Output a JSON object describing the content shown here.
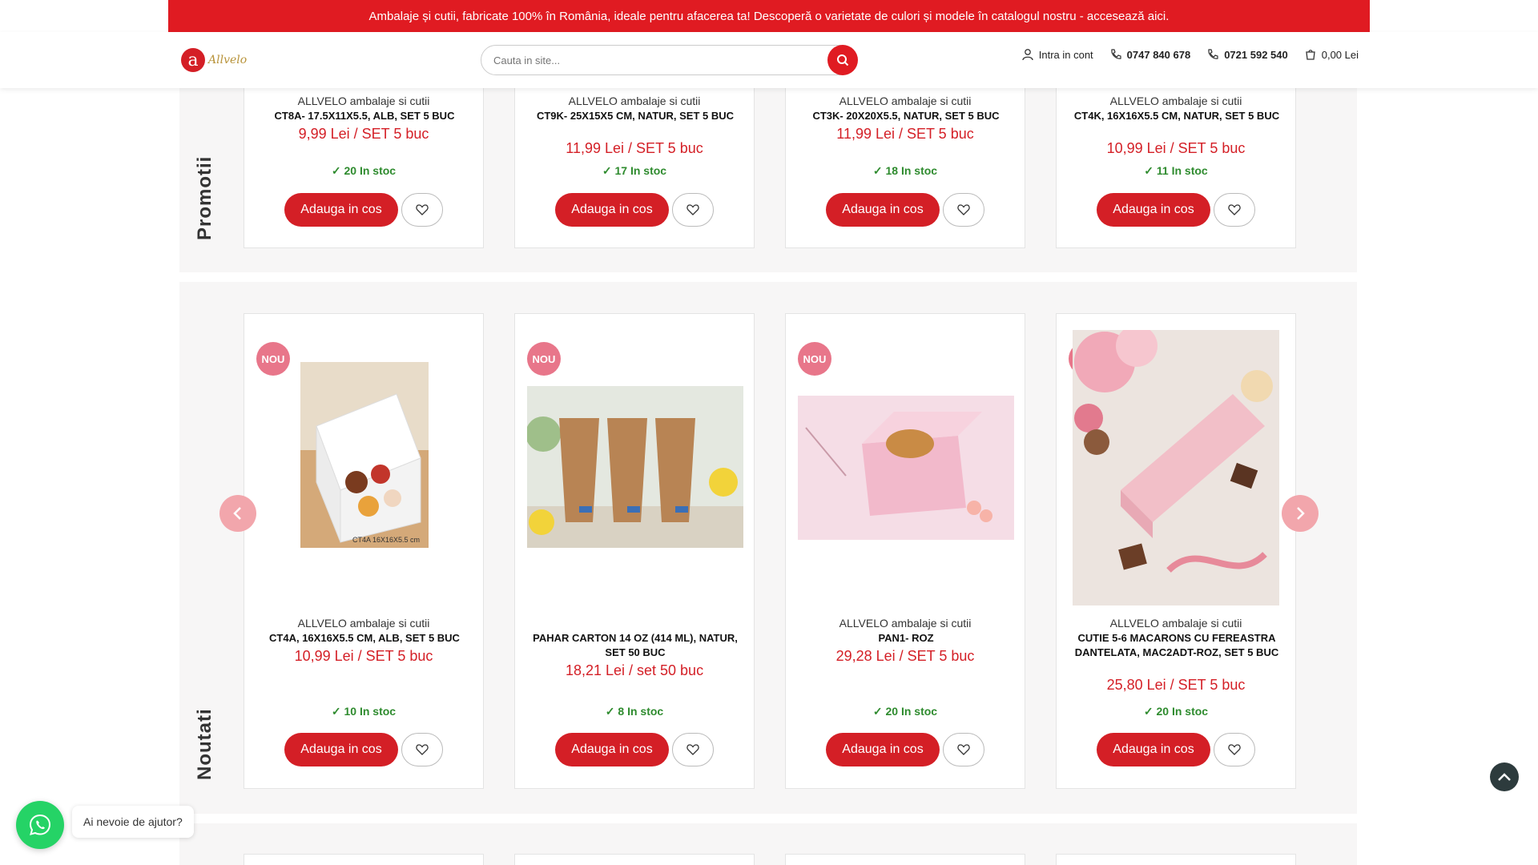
{
  "topbar": {
    "text": "Ambalaje și cutii, fabricate 100% în România, ideale pentru afacerea ta! Descoperă o varietate de culori și modele în catalogul nostru - accesează aici."
  },
  "header": {
    "logo_mark": "a",
    "logo_text": "Allvelo",
    "search_placeholder": "Cauta in site...",
    "account_label": "Intra in cont",
    "phone1": "0747 840 678",
    "phone2": "0721 592 540",
    "cart_total": "0,00 Lei"
  },
  "colors": {
    "brand_red": "#d41f26",
    "topbar_red": "#e01b22",
    "stock_green": "#2e8b2e",
    "badge_pink": "#e8768a"
  },
  "sections": {
    "promotii": {
      "label": "Promotii",
      "products": [
        {
          "brand": "ALLVELO ambalaje si cutii",
          "name": "CT8A- 17.5X11X5.5, ALB, SET 5 BUC",
          "price": "9,99 Lei / SET 5 buc",
          "stock": "20 In stoc",
          "add_label": "Adauga in cos"
        },
        {
          "brand": "ALLVELO ambalaje si cutii",
          "name": "CT9K- 25X15X5 CM, NATUR, SET 5 BUC",
          "price": "11,99 Lei / SET 5 buc",
          "stock": "17 In stoc",
          "add_label": "Adauga in cos"
        },
        {
          "brand": "ALLVELO ambalaje si cutii",
          "name": "CT3K- 20X20X5.5, NATUR, SET 5 BUC",
          "price": "11,99 Lei / SET 5 buc",
          "stock": "18 In stoc",
          "add_label": "Adauga in cos"
        },
        {
          "brand": "ALLVELO ambalaje si cutii",
          "name": "CT4K, 16X16X5.5 CM, NATUR, SET 5 BUC",
          "price": "10,99 Lei / SET 5 buc",
          "stock": "11 In stoc",
          "add_label": "Adauga in cos"
        }
      ]
    },
    "noutati": {
      "label": "Noutati",
      "badge": "NOU",
      "products": [
        {
          "brand": "ALLVELO ambalaje si cutii",
          "name": "CT4A, 16X16X5.5 CM, ALB, SET 5 BUC",
          "price": "10,99 Lei / SET 5 buc",
          "stock": "10 In stoc",
          "add_label": "Adauga in cos",
          "image_caption": "CT4A 16X16X5.5 cm"
        },
        {
          "brand": "",
          "name": "PAHAR CARTON 14 OZ (414 ML), NATUR, SET 50 BUC",
          "price": "18,21 Lei / set 50 buc",
          "stock": "8 In stoc",
          "add_label": "Adauga in cos"
        },
        {
          "brand": "ALLVELO ambalaje si cutii",
          "name": "PAN1- ROZ",
          "price": "29,28 Lei / SET 5 buc",
          "stock": "20 In stoc",
          "add_label": "Adauga in cos"
        },
        {
          "brand": "ALLVELO ambalaje si cutii",
          "name": "CUTIE 5-6 MACARONS CU FEREASTRA DANTELATA, MAC2ADT-ROZ, SET 5 BUC",
          "price": "25,80 Lei / SET 5 buc",
          "stock": "20 In stoc",
          "add_label": "Adauga in cos"
        }
      ]
    }
  },
  "icons": {
    "search": "search-icon",
    "user": "user-icon",
    "phone": "phone-icon",
    "cart": "cart-icon",
    "heart": "heart-icon",
    "check": "check-icon",
    "prev": "chevron-left-icon",
    "next": "chevron-right-icon",
    "to_top": "chevron-up-icon",
    "whatsapp": "whatsapp-icon"
  },
  "help_widget": {
    "text": "Ai nevoie de ajutor?"
  }
}
